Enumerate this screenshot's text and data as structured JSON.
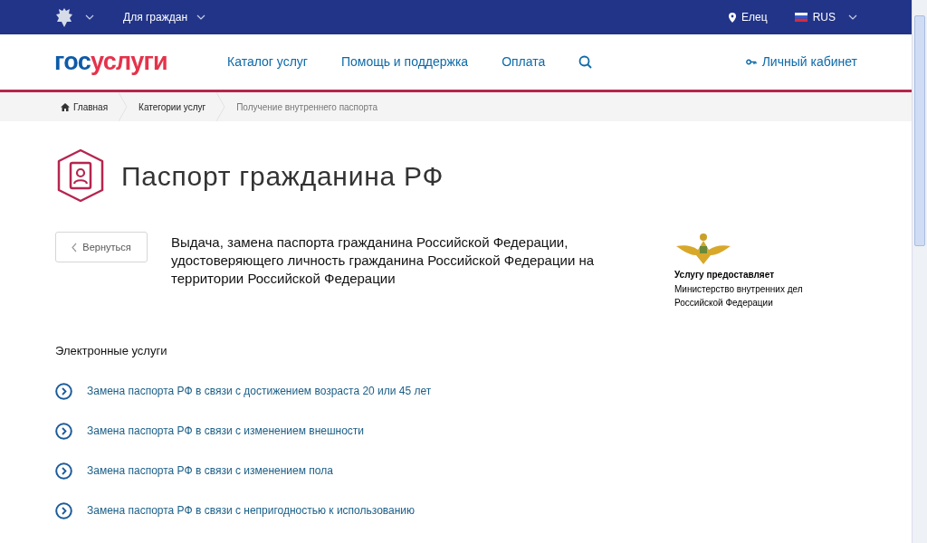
{
  "top_bar": {
    "audience": "Для граждан",
    "location": "Елец",
    "language": "RUS"
  },
  "header": {
    "logo": [
      "гос",
      "услуги"
    ],
    "nav": [
      "Каталог услуг",
      "Помощь и поддержка",
      "Оплата"
    ],
    "account": "Личный кабинет"
  },
  "breadcrumbs": [
    "Главная",
    "Категории услуг",
    "Получение внутреннего паспорта"
  ],
  "page_title": "Паспорт гражданина РФ",
  "back_button": "Вернуться",
  "service_title": "Выдача, замена паспорта гражданина Российской Федерации, удостоверяющего личность гражданина Российской Федерации на территории Российской Федерации",
  "provider": {
    "label": "Услугу предоставляет",
    "name": "Министерство внутренних дел Российской Федерации"
  },
  "electronic_services": {
    "heading": "Электронные услуги",
    "items": [
      "Замена паспорта РФ в связи с достижением возраста 20 или 45 лет",
      "Замена паспорта РФ в связи с изменением внешности",
      "Замена паспорта РФ в связи с изменением пола",
      "Замена паспорта РФ в связи с непригодностью к использованию"
    ]
  }
}
